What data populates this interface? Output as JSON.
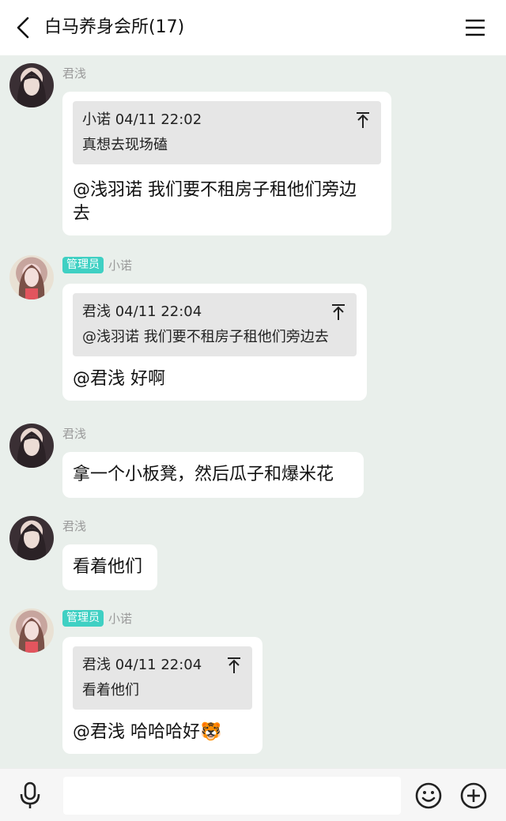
{
  "header": {
    "title": "白马养身会所(17)"
  },
  "messages": [
    {
      "sender": "君浅",
      "quote": {
        "head": "小诺 04/11 22:02",
        "text": "真想去现场磕"
      },
      "text_line1": "@浅羽诺 我们要不租房子租他们旁边",
      "text_line2": "去"
    },
    {
      "badge": "管理员",
      "sender": "小诺",
      "quote": {
        "head": "君浅 04/11 22:04",
        "text": "@浅羽诺 我们要不租房子租他们旁边去"
      },
      "text": "@君浅 好啊"
    },
    {
      "sender": "君浅",
      "text": "拿一个小板凳，然后瓜子和爆米花"
    },
    {
      "sender": "君浅",
      "text": "看着他们"
    },
    {
      "badge": "管理员",
      "sender": "小诺",
      "quote": {
        "head": "君浅 04/11 22:04",
        "text": "看着他们"
      },
      "text": "@君浅 哈哈哈好",
      "emoji": "🐯"
    }
  ],
  "icons": {
    "back": "back-arrow-icon",
    "menu": "menu-icon",
    "pin": "pin-top-icon",
    "mic": "microphone-icon",
    "emoji": "smiley-icon",
    "plus": "plus-circle-icon"
  },
  "colors": {
    "background": "#e9efeb",
    "badge": "#3fd0c3",
    "quote_bg": "#e6e6e6",
    "bubble": "#ffffff"
  },
  "input": {
    "value": "",
    "placeholder": ""
  }
}
